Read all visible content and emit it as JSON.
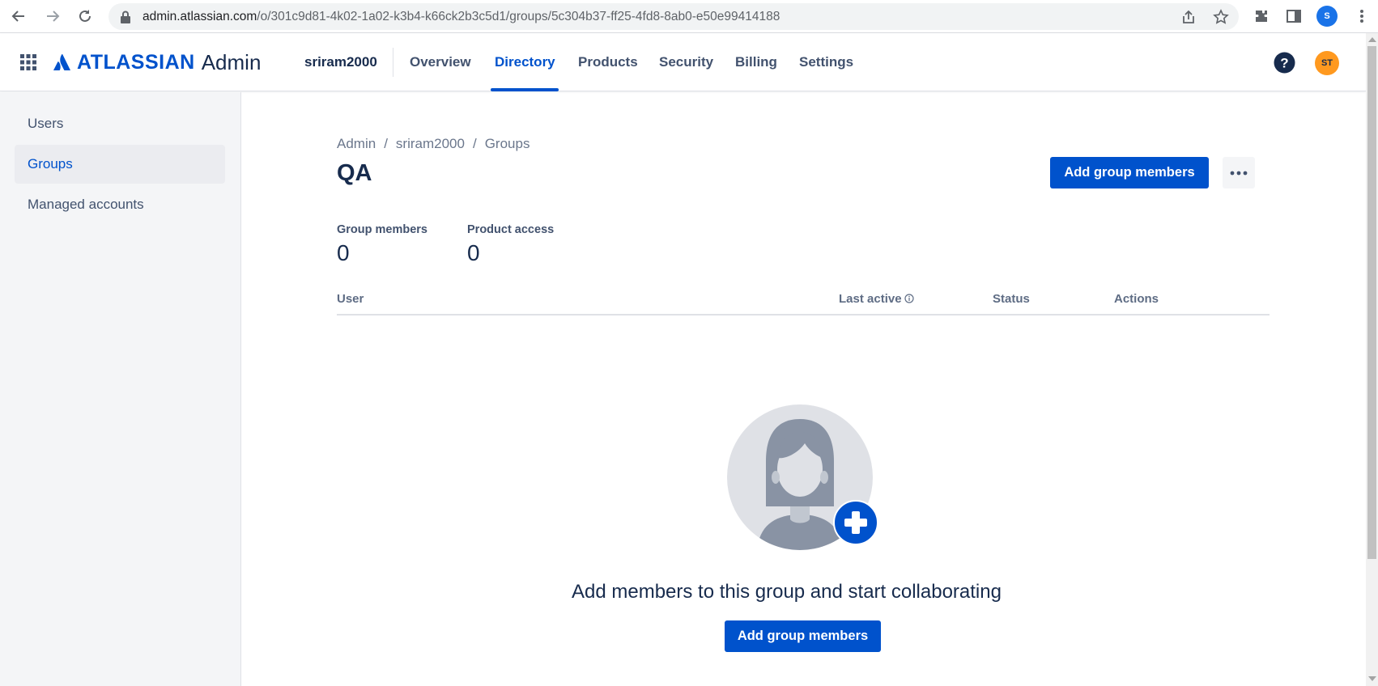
{
  "browser": {
    "url_host": "admin.atlassian.com",
    "url_path": "/o/301c9d81-4k02-1a02-k3b4-k66ck2b3c5d1/groups/5c304b37-ff25-4fd8-8ab0-e50e99414188",
    "profile_initial": "S"
  },
  "header": {
    "logo_text": "ATLASSIAN",
    "logo_suffix": "Admin",
    "org_name": "sriram2000",
    "tabs": [
      {
        "label": "Overview"
      },
      {
        "label": "Directory"
      },
      {
        "label": "Products"
      },
      {
        "label": "Security"
      },
      {
        "label": "Billing"
      },
      {
        "label": "Settings"
      }
    ],
    "active_tab": "Directory",
    "avatar_initials": "ST"
  },
  "sidebar": {
    "items": [
      {
        "label": "Users"
      },
      {
        "label": "Groups"
      },
      {
        "label": "Managed accounts"
      }
    ],
    "active_item": "Groups"
  },
  "breadcrumb": [
    "Admin",
    "sriram2000",
    "Groups"
  ],
  "page": {
    "title": "QA",
    "add_members_label": "Add group members"
  },
  "stats": [
    {
      "label": "Group members",
      "value": "0"
    },
    {
      "label": "Product access",
      "value": "0"
    }
  ],
  "table": {
    "columns": [
      "User",
      "Last active",
      "Status",
      "Actions"
    ]
  },
  "empty_state": {
    "message": "Add members to this group and start collaborating",
    "button_label": "Add group members"
  },
  "colors": {
    "brand_blue": "#0052cc",
    "avatar_orange": "#ff991f"
  }
}
